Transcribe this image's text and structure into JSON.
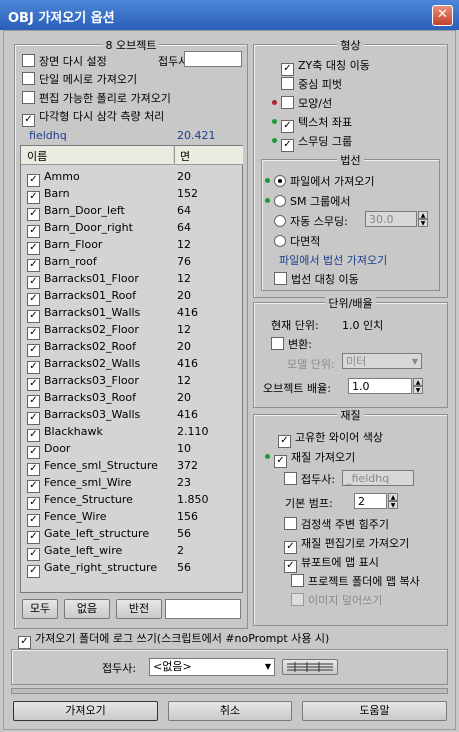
{
  "title": "OBJ 가져오기 옵션",
  "objects": {
    "group_title": "8 오브젝트",
    "reset_scene": "장면 다시 설정",
    "prefix_label": "접두사:",
    "single_mesh": "단일 메시로 가져오기",
    "editable_poly": "편집 가능한 폴리로 가져오기",
    "retriangulate": "다각형 다시 삼각 측량 처리",
    "file_name": "fieldhq",
    "file_value": "20.421",
    "col_name": "이름",
    "col_faces": "면",
    "items": [
      {
        "name": "Ammo",
        "faces": "20"
      },
      {
        "name": "Barn",
        "faces": "152"
      },
      {
        "name": "Barn_Door_left",
        "faces": "64"
      },
      {
        "name": "Barn_Door_right",
        "faces": "64"
      },
      {
        "name": "Barn_Floor",
        "faces": "12"
      },
      {
        "name": "Barn_roof",
        "faces": "76"
      },
      {
        "name": "Barracks01_Floor",
        "faces": "12"
      },
      {
        "name": "Barracks01_Roof",
        "faces": "20"
      },
      {
        "name": "Barracks01_Walls",
        "faces": "416"
      },
      {
        "name": "Barracks02_Floor",
        "faces": "12"
      },
      {
        "name": "Barracks02_Roof",
        "faces": "20"
      },
      {
        "name": "Barracks02_Walls",
        "faces": "416"
      },
      {
        "name": "Barracks03_Floor",
        "faces": "12"
      },
      {
        "name": "Barracks03_Roof",
        "faces": "20"
      },
      {
        "name": "Barracks03_Walls",
        "faces": "416"
      },
      {
        "name": "Blackhawk",
        "faces": "2.110"
      },
      {
        "name": "Door",
        "faces": "10"
      },
      {
        "name": "Fence_sml_Structure",
        "faces": "372"
      },
      {
        "name": "Fence_sml_Wire",
        "faces": "23"
      },
      {
        "name": "Fence_Structure",
        "faces": "1.850"
      },
      {
        "name": "Fence_Wire",
        "faces": "156"
      },
      {
        "name": "Gate_left_structure",
        "faces": "56"
      },
      {
        "name": "Gate_left_wire",
        "faces": "2"
      },
      {
        "name": "Gate_right_structure",
        "faces": "56"
      }
    ],
    "btn_all": "모두",
    "btn_none": "없음",
    "btn_invert": "반전"
  },
  "geometry": {
    "title": "형상",
    "flip_zy": "ZY축 대칭 이동",
    "center_pivot": "중심 피벗",
    "shapes_lines": "모양/선",
    "tex_coords": "텍스처 좌표",
    "smooth_groups": "스무딩 그룹"
  },
  "normals": {
    "title": "법선",
    "from_file": "파일에서 가져오기",
    "from_sm": "SM 그룹에서",
    "auto_smooth": "자동 스무딩:",
    "auto_smooth_value": "30.0",
    "faceted": "다면적",
    "from_file_note": "파일에서 법선 가져오기",
    "flip_normals": "법선 대칭 이동"
  },
  "units": {
    "title": "단위/배율",
    "current_label": "현재 단위:",
    "current_value": "1.0 인치",
    "convert": "변환:",
    "model_units_label": "모델 단위:",
    "model_units_value": "미터",
    "scale_label": "오브젝트 배율:",
    "scale_value": "1.0"
  },
  "materials": {
    "title": "재질",
    "unique_wire": "고유한 와이어 색상",
    "import_materials": "재질 가져오기",
    "prefix_label": "접두사:",
    "prefix_value": "_fieldhq",
    "bump_label": "기본 범프:",
    "bump_value": "2",
    "force_black_ambient": "검정색 주변 힘주기",
    "import_into_editor": "재질 편집기로 가져오기",
    "show_maps_viewport": "뷰포트에 맵 표시",
    "copy_maps_project": "프로젝트 폴더에 맵 복사",
    "overwrite_images": "이미지 덮어쓰기"
  },
  "footer": {
    "log_option": "가져오기 폴더에 로그 쓰기(스크립트에서 #noPrompt 사용 시)",
    "prefix_label": "접두사:",
    "prefix_select": "<없음>",
    "import": "가져오기",
    "cancel": "취소",
    "help": "도움말"
  },
  "colors": {
    "title_bar": "#2f6bc4",
    "active_dot": "#1a9a3a",
    "inactive_dot": "#b0203a"
  }
}
